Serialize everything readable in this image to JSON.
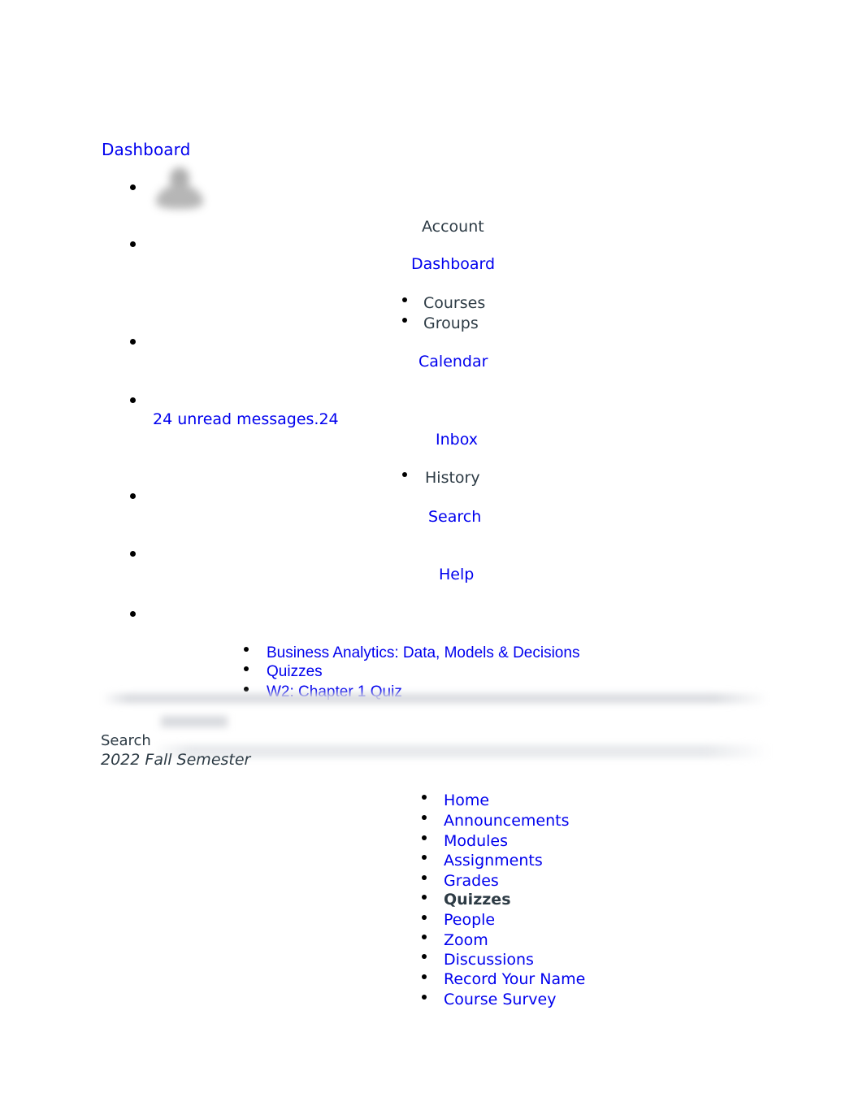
{
  "page": {
    "top_link": "Dashboard",
    "search_label": "Search",
    "semester": "2022 Fall Semester"
  },
  "avatar": {
    "icon": "user-avatar-placeholder-icon"
  },
  "global_nav": {
    "account": "Account",
    "dashboard": "Dashboard",
    "courses": "Courses",
    "groups": "Groups",
    "calendar": "Calendar",
    "unread_messages": "24 unread messages.24",
    "inbox": "Inbox",
    "history": "History",
    "search": "Search",
    "help": "Help"
  },
  "breadcrumb": {
    "items": [
      {
        "label": "Business Analytics: Data, Models & Decisions"
      },
      {
        "label": "Quizzes"
      },
      {
        "label": "W2: Chapter 1 Quiz"
      }
    ]
  },
  "course_nav": {
    "items": [
      {
        "label": "Home",
        "active": false
      },
      {
        "label": "Announcements",
        "active": false
      },
      {
        "label": "Modules",
        "active": false
      },
      {
        "label": "Assignments",
        "active": false
      },
      {
        "label": "Grades",
        "active": false
      },
      {
        "label": "Quizzes",
        "active": true
      },
      {
        "label": "People",
        "active": false
      },
      {
        "label": "Zoom",
        "active": false
      },
      {
        "label": "Discussions",
        "active": false
      },
      {
        "label": "Record Your Name",
        "active": false
      },
      {
        "label": "Course Survey",
        "active": false
      }
    ]
  },
  "colors": {
    "link": "#0000ee",
    "text": "#2d3b45",
    "background": "#ffffff"
  }
}
